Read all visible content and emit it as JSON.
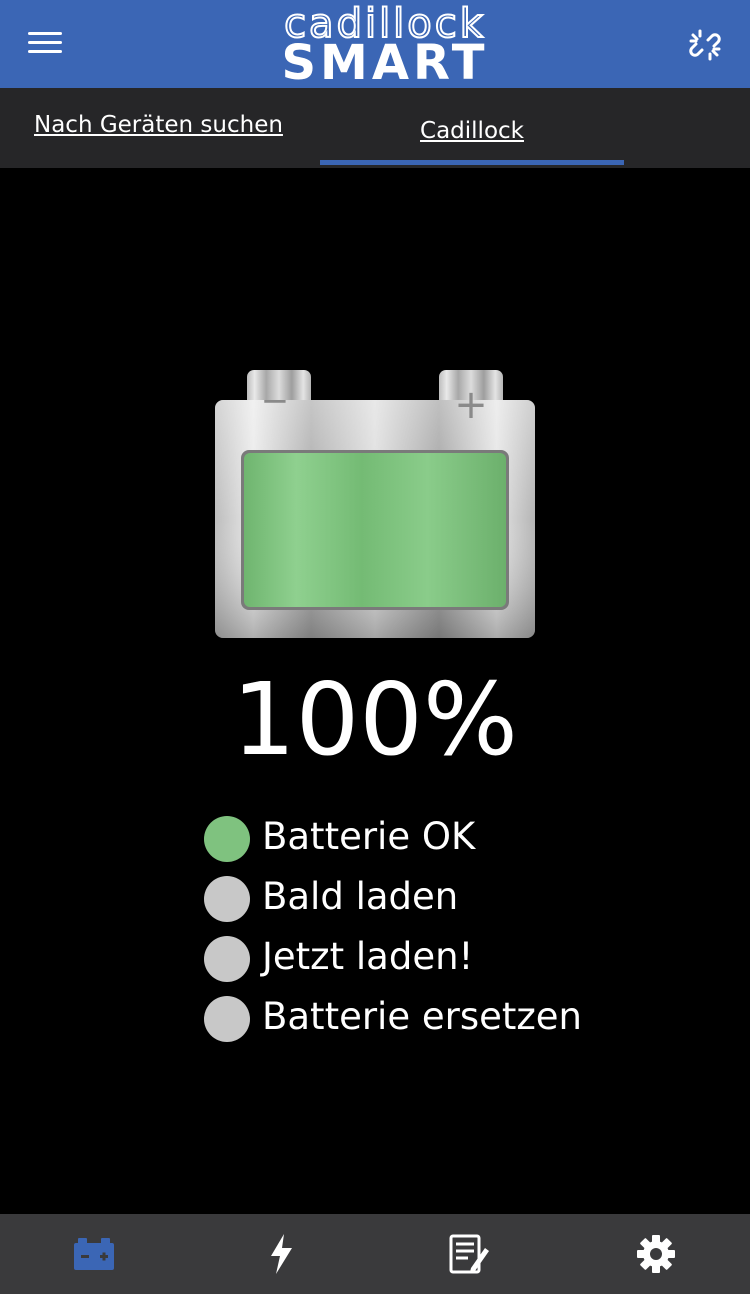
{
  "header": {
    "logo_line1": "cadillock",
    "logo_line2": "SMART",
    "menu_icon": "hamburger-menu-icon",
    "unlink_icon": "broken-link-icon",
    "bg_color": "#3b66b5"
  },
  "tabs": [
    {
      "label": "Nach Geräten suchen",
      "active": false
    },
    {
      "label": "Cadillock",
      "active": true
    }
  ],
  "battery": {
    "level_percent": 100,
    "display": "100%",
    "fill_color": "#7fc27f",
    "minus_label": "−",
    "plus_label": "+"
  },
  "status": [
    {
      "label": "Batterie OK",
      "active": true,
      "color": "#7fc27f"
    },
    {
      "label": "Bald laden",
      "active": false,
      "color": "#c8c8c8"
    },
    {
      "label": "Jetzt laden!",
      "active": false,
      "color": "#c8c8c8"
    },
    {
      "label": "Batterie ersetzen",
      "active": false,
      "color": "#c8c8c8"
    }
  ],
  "bottom_nav": [
    {
      "icon": "battery-icon",
      "active": true,
      "color": "#3b66b5"
    },
    {
      "icon": "lightning-icon",
      "active": false,
      "color": "#ffffff"
    },
    {
      "icon": "notepad-icon",
      "active": false,
      "color": "#ffffff"
    },
    {
      "icon": "gear-icon",
      "active": false,
      "color": "#ffffff"
    }
  ]
}
